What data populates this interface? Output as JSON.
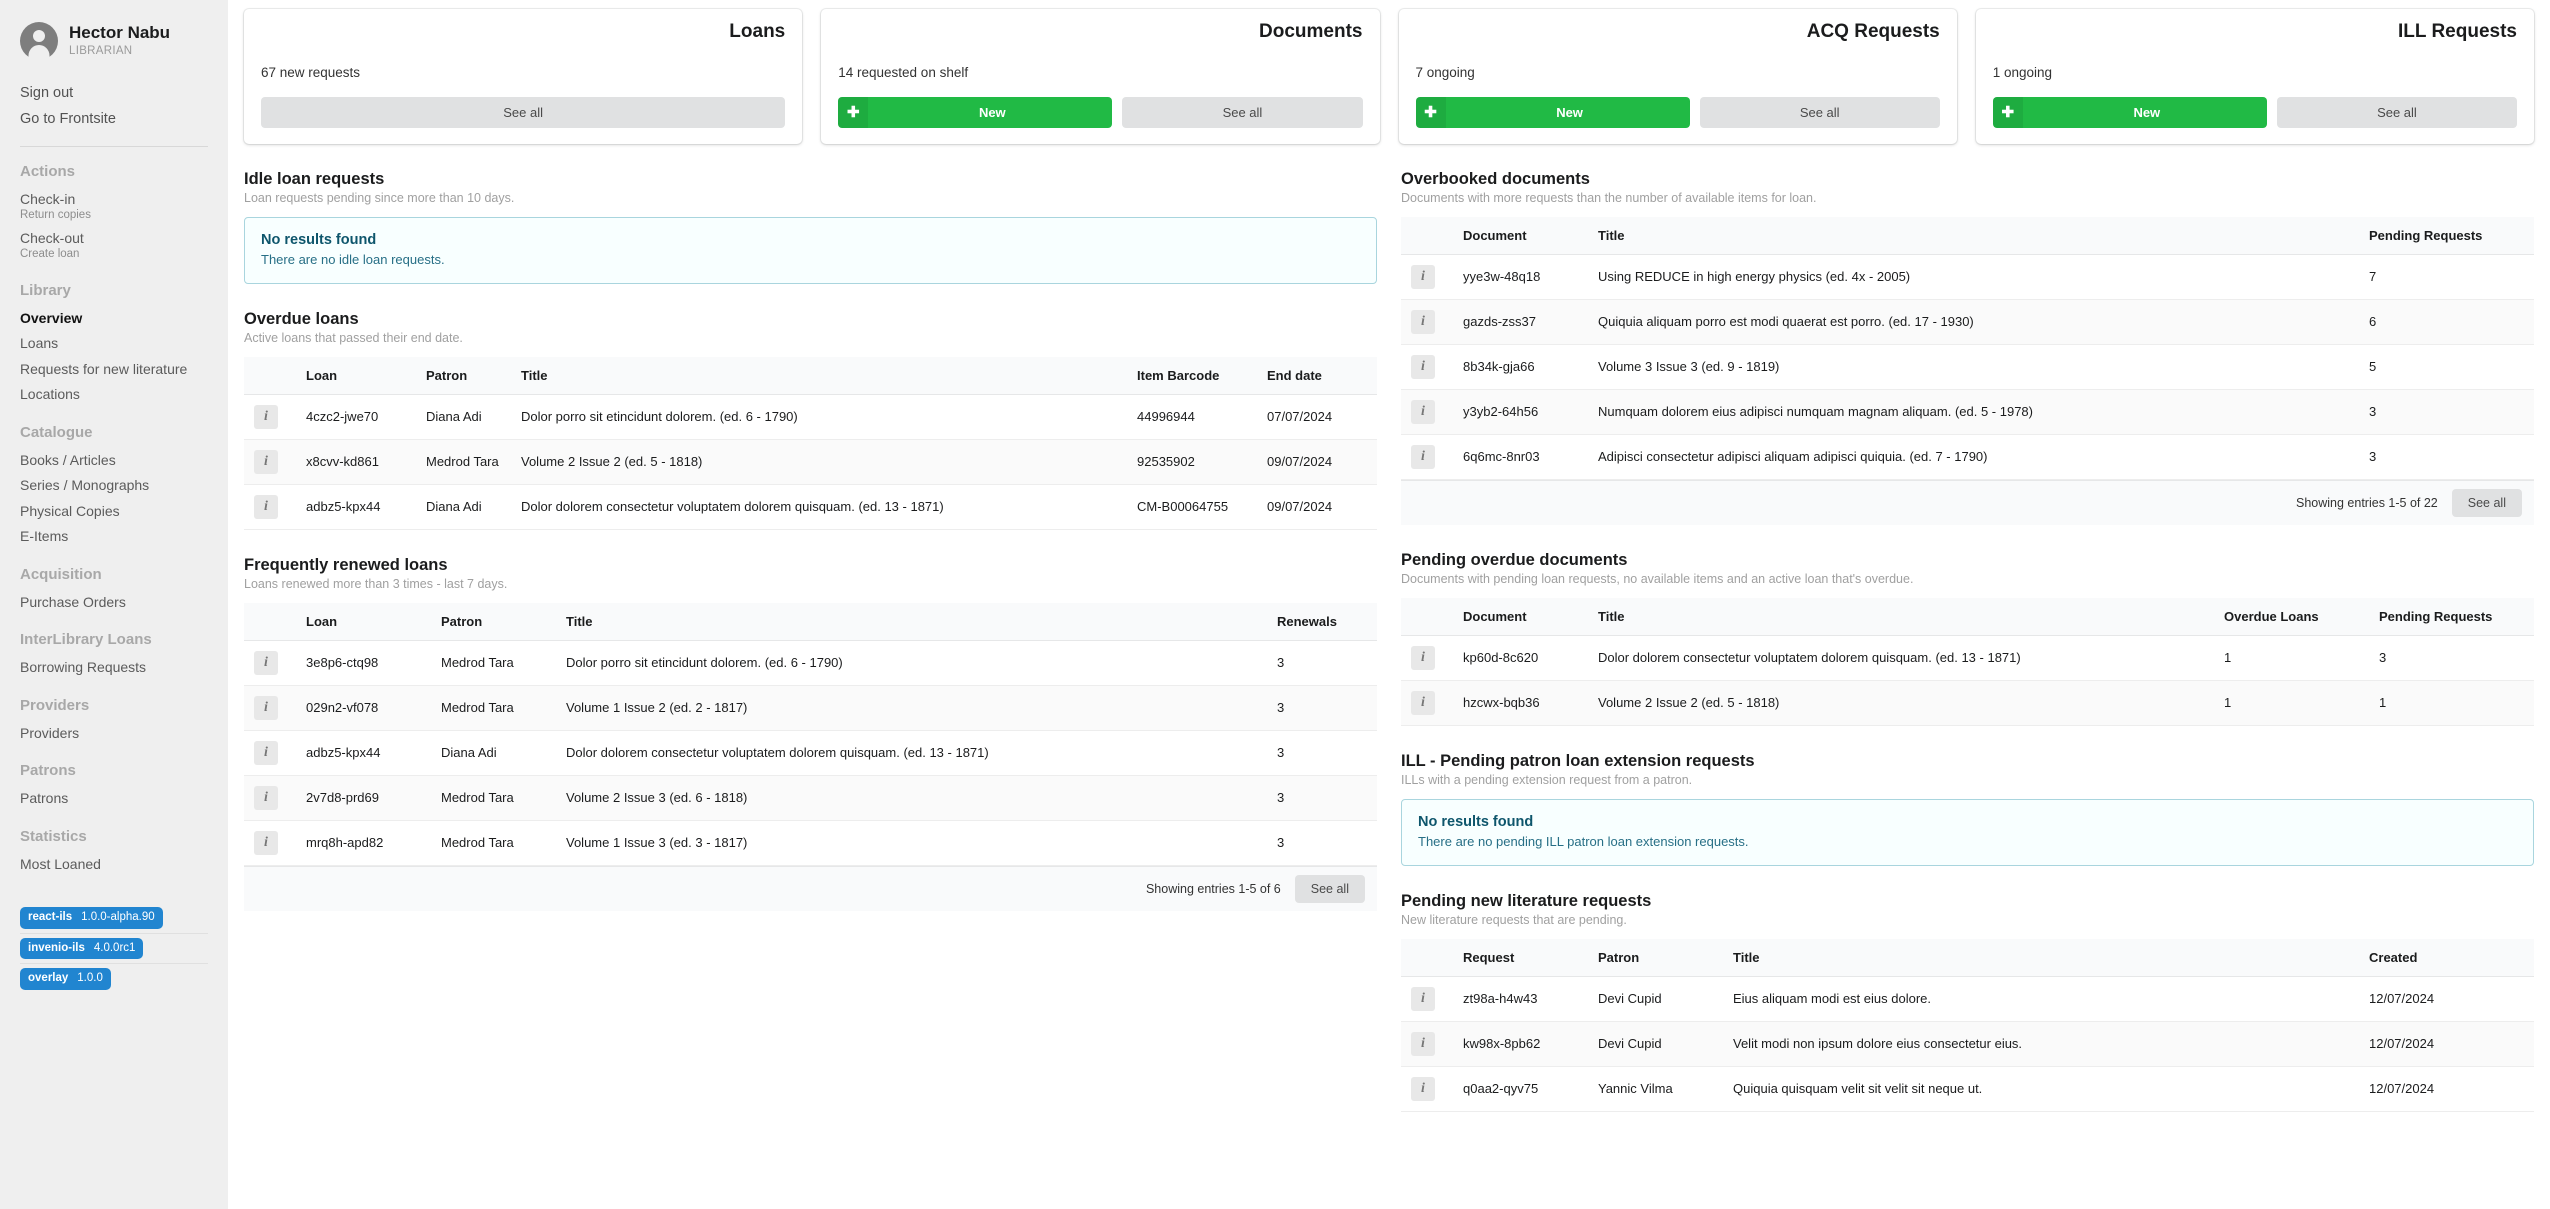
{
  "sidebar": {
    "user": {
      "name": "Hector Nabu",
      "role": "LIBRARIAN"
    },
    "account_links": [
      {
        "label": "Sign out"
      },
      {
        "label": "Go to Frontsite"
      }
    ],
    "groups": [
      {
        "title": "Actions",
        "items": [
          {
            "label": "Check-in",
            "sub": "Return copies",
            "active": false
          },
          {
            "label": "Check-out",
            "sub": "Create loan",
            "active": false
          }
        ]
      },
      {
        "title": "Library",
        "items": [
          {
            "label": "Overview",
            "sub": "",
            "active": true
          },
          {
            "label": "Loans",
            "sub": "",
            "active": false
          },
          {
            "label": "Requests for new literature",
            "sub": "",
            "active": false
          },
          {
            "label": "Locations",
            "sub": "",
            "active": false
          }
        ]
      },
      {
        "title": "Catalogue",
        "items": [
          {
            "label": "Books / Articles",
            "sub": "",
            "active": false
          },
          {
            "label": "Series / Monographs",
            "sub": "",
            "active": false
          },
          {
            "label": "Physical Copies",
            "sub": "",
            "active": false
          },
          {
            "label": "E-Items",
            "sub": "",
            "active": false
          }
        ]
      },
      {
        "title": "Acquisition",
        "items": [
          {
            "label": "Purchase Orders",
            "sub": "",
            "active": false
          }
        ]
      },
      {
        "title": "InterLibrary Loans",
        "items": [
          {
            "label": "Borrowing Requests",
            "sub": "",
            "active": false
          }
        ]
      },
      {
        "title": "Providers",
        "items": [
          {
            "label": "Providers",
            "sub": "",
            "active": false
          }
        ]
      },
      {
        "title": "Patrons",
        "items": [
          {
            "label": "Patrons",
            "sub": "",
            "active": false
          }
        ]
      },
      {
        "title": "Statistics",
        "items": [
          {
            "label": "Most Loaned",
            "sub": "",
            "active": false
          }
        ]
      }
    ],
    "versions": [
      {
        "name": "react-ils",
        "version": "1.0.0-alpha.90"
      },
      {
        "name": "invenio-ils",
        "version": "4.0.0rc1"
      },
      {
        "name": "overlay",
        "version": "1.0.0"
      }
    ],
    "badge_color": "#2185d0"
  },
  "cards": [
    {
      "title": "Loans",
      "subtitle": "67 new requests",
      "has_new": false,
      "new_label": "New",
      "see_all_label": "See all"
    },
    {
      "title": "Documents",
      "subtitle": "14 requested on shelf",
      "has_new": true,
      "new_label": "New",
      "see_all_label": "See all"
    },
    {
      "title": "ACQ Requests",
      "subtitle": "7 ongoing",
      "has_new": true,
      "new_label": "New",
      "see_all_label": "See all"
    },
    {
      "title": "ILL Requests",
      "subtitle": "1 ongoing",
      "has_new": true,
      "new_label": "New",
      "see_all_label": "See all"
    }
  ],
  "idle_loan_requests": {
    "title": "Idle loan requests",
    "subtitle": "Loan requests pending since more than 10 days.",
    "empty_title": "No results found",
    "empty_text": "There are no idle loan requests."
  },
  "overdue_loans": {
    "title": "Overdue loans",
    "subtitle": "Active loans that passed their end date.",
    "columns": [
      "",
      "Loan",
      "Patron",
      "Title",
      "Item Barcode",
      "End date"
    ],
    "rows": [
      {
        "loan": "4czc2-jwe70",
        "patron": "Diana Adi",
        "title": "Dolor porro sit etincidunt dolorem. (ed. 6 - 1790)",
        "barcode": "44996944",
        "end_date": "07/07/2024"
      },
      {
        "loan": "x8cvv-kd861",
        "patron": "Medrod Tara",
        "title": "Volume 2 Issue 2 (ed. 5 - 1818)",
        "barcode": "92535902",
        "end_date": "09/07/2024"
      },
      {
        "loan": "adbz5-kpx44",
        "patron": "Diana Adi",
        "title": "Dolor dolorem consectetur voluptatem dolorem quisquam. (ed. 13 - 1871)",
        "barcode": "CM-B00064755",
        "end_date": "09/07/2024"
      }
    ]
  },
  "frequently_renewed_loans": {
    "title": "Frequently renewed loans",
    "subtitle": "Loans renewed more than 3 times - last 7 days.",
    "columns": [
      "",
      "Loan",
      "Patron",
      "Title",
      "Renewals"
    ],
    "rows": [
      {
        "loan": "3e8p6-ctq98",
        "patron": "Medrod Tara",
        "title": "Dolor porro sit etincidunt dolorem. (ed. 6 - 1790)",
        "renewals": "3"
      },
      {
        "loan": "029n2-vf078",
        "patron": "Medrod Tara",
        "title": "Volume 1 Issue 2 (ed. 2 - 1817)",
        "renewals": "3"
      },
      {
        "loan": "adbz5-kpx44",
        "patron": "Diana Adi",
        "title": "Dolor dolorem consectetur voluptatem dolorem quisquam. (ed. 13 - 1871)",
        "renewals": "3"
      },
      {
        "loan": "2v7d8-prd69",
        "patron": "Medrod Tara",
        "title": "Volume 2 Issue 3 (ed. 6 - 1818)",
        "renewals": "3"
      },
      {
        "loan": "mrq8h-apd82",
        "patron": "Medrod Tara",
        "title": "Volume 1 Issue 3 (ed. 3 - 1817)",
        "renewals": "3"
      }
    ],
    "footer_text": "Showing entries 1-5 of 6",
    "see_all_label": "See all"
  },
  "overbooked_documents": {
    "title": "Overbooked documents",
    "subtitle": "Documents with more requests than the number of available items for loan.",
    "columns": [
      "",
      "Document",
      "Title",
      "Pending Requests"
    ],
    "rows": [
      {
        "document": "yye3w-48q18",
        "title": "Using REDUCE in high energy physics (ed. 4x - 2005)",
        "pending": "7"
      },
      {
        "document": "gazds-zss37",
        "title": "Quiquia aliquam porro est modi quaerat est porro. (ed. 17 - 1930)",
        "pending": "6"
      },
      {
        "document": "8b34k-gja66",
        "title": "Volume 3 Issue 3 (ed. 9 - 1819)",
        "pending": "5"
      },
      {
        "document": "y3yb2-64h56",
        "title": "Numquam dolorem eius adipisci numquam magnam aliquam. (ed. 5 - 1978)",
        "pending": "3"
      },
      {
        "document": "6q6mc-8nr03",
        "title": "Adipisci consectetur adipisci aliquam adipisci quiquia. (ed. 7 - 1790)",
        "pending": "3"
      }
    ],
    "footer_text": "Showing entries 1-5 of 22",
    "see_all_label": "See all"
  },
  "pending_overdue_documents": {
    "title": "Pending overdue documents",
    "subtitle": "Documents with pending loan requests, no available items and an active loan that's overdue.",
    "columns": [
      "",
      "Document",
      "Title",
      "Overdue Loans",
      "Pending Requests"
    ],
    "rows": [
      {
        "document": "kp60d-8c620",
        "title": "Dolor dolorem consectetur voluptatem dolorem quisquam. (ed. 13 - 1871)",
        "overdue": "1",
        "pending": "3"
      },
      {
        "document": "hzcwx-bqb36",
        "title": "Volume 2 Issue 2 (ed. 5 - 1818)",
        "overdue": "1",
        "pending": "1"
      }
    ]
  },
  "ill_pending_extension": {
    "title": "ILL - Pending patron loan extension requests",
    "subtitle": "ILLs with a pending extension request from a patron.",
    "empty_title": "No results found",
    "empty_text": "There are no pending ILL patron loan extension requests."
  },
  "pending_new_literature": {
    "title": "Pending new literature requests",
    "subtitle": "New literature requests that are pending.",
    "columns": [
      "",
      "Request",
      "Patron",
      "Title",
      "Created"
    ],
    "rows": [
      {
        "request": "zt98a-h4w43",
        "patron": "Devi Cupid",
        "title": "Eius aliquam modi est eius dolore.",
        "created": "12/07/2024"
      },
      {
        "request": "kw98x-8pb62",
        "patron": "Devi Cupid",
        "title": "Velit modi non ipsum dolore eius consectetur eius.",
        "created": "12/07/2024"
      },
      {
        "request": "q0aa2-qyv75",
        "patron": "Yannic Vilma",
        "title": "Quiquia quisquam velit sit velit sit neque ut.",
        "created": "12/07/2024"
      }
    ]
  },
  "colors": {
    "green": "#21ba45",
    "blue": "#2185d0",
    "grey_btn": "#e0e1e2"
  }
}
